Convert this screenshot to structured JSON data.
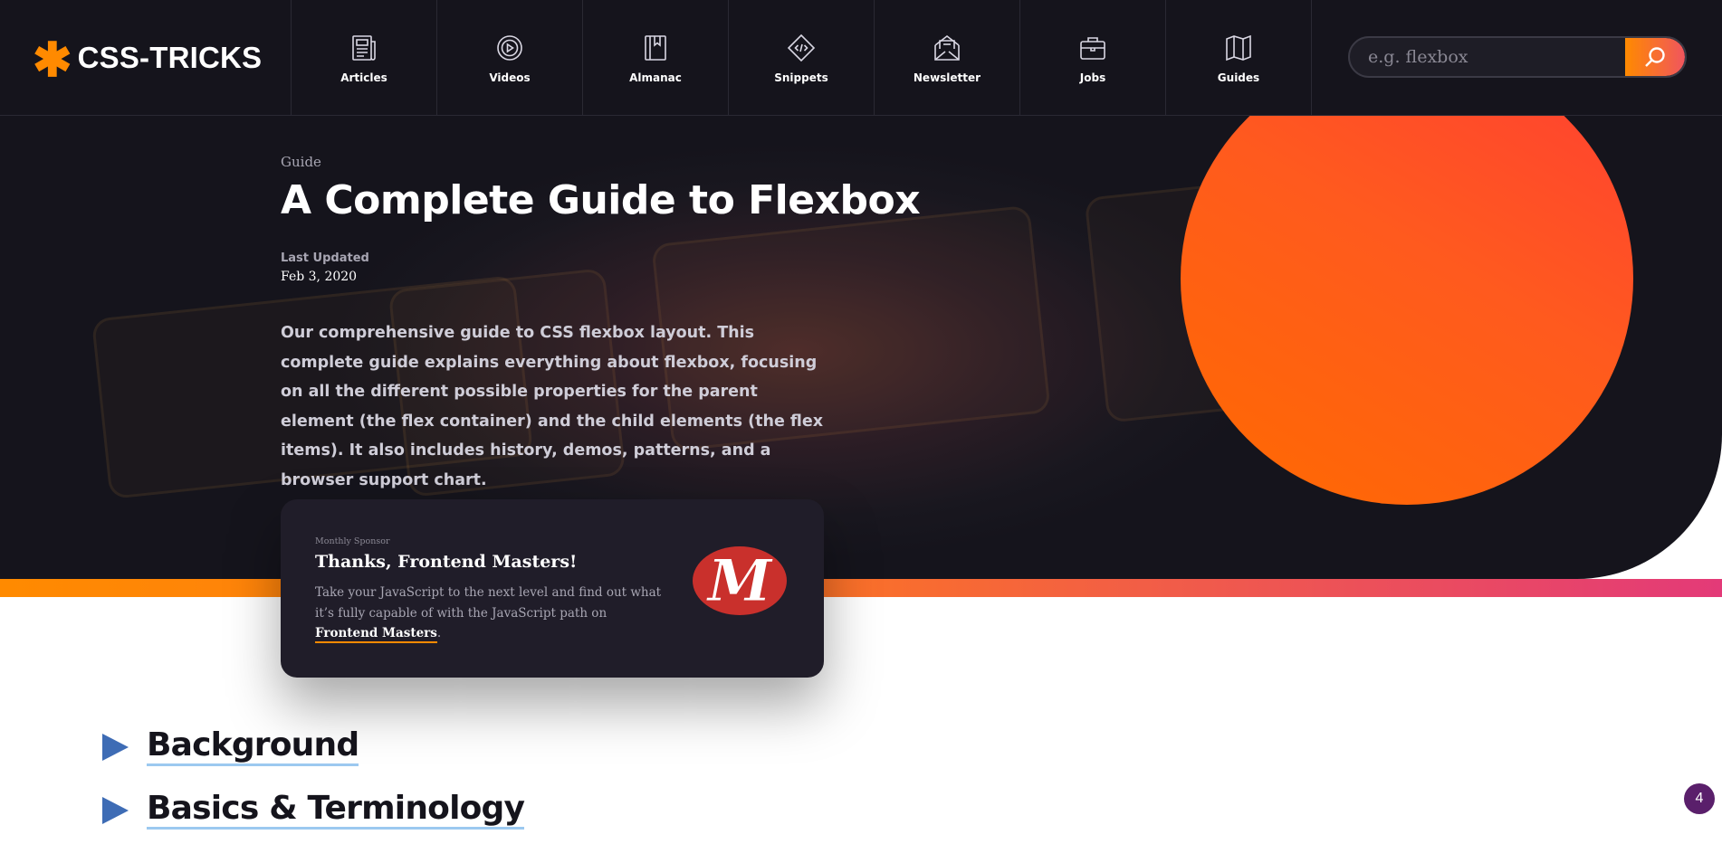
{
  "header": {
    "logo_text": "CSS-TRICKS",
    "nav": [
      {
        "label": "Articles",
        "icon": "newspaper-icon"
      },
      {
        "label": "Videos",
        "icon": "play-circle-icon"
      },
      {
        "label": "Almanac",
        "icon": "book-icon"
      },
      {
        "label": "Snippets",
        "icon": "code-icon"
      },
      {
        "label": "Newsletter",
        "icon": "envelope-icon"
      },
      {
        "label": "Jobs",
        "icon": "briefcase-icon"
      },
      {
        "label": "Guides",
        "icon": "map-icon"
      }
    ],
    "search_placeholder": "e.g. flexbox"
  },
  "hero": {
    "kicker": "Guide",
    "title": "A Complete Guide to Flexbox",
    "updated_label": "Last Updated",
    "updated_date": "Feb 3, 2020",
    "lede": "Our comprehensive guide to CSS flexbox layout. This complete guide explains everything about flexbox, focusing on all the different possible properties for the parent element (the flex container) and the child elements (the flex items). It also includes history, demos, patterns, and a browser support chart."
  },
  "sponsor": {
    "kicker": "Monthly Sponsor",
    "title": "Thanks, Frontend Masters!",
    "text": "Take your JavaScript to the next level and find out what it’s fully capable of with the JavaScript path on ",
    "link": "Frontend Masters",
    "period": ".",
    "logo_letter": "M"
  },
  "sections": [
    {
      "title": "Background"
    },
    {
      "title": "Basics & Terminology"
    }
  ],
  "notification_count": "4",
  "colors": {
    "accent_orange": "#ff8a00",
    "header_bg": "#15141c",
    "card_bg": "#201d29",
    "section_arrow": "#3e6cb5",
    "badge": "#5a1f6b"
  }
}
